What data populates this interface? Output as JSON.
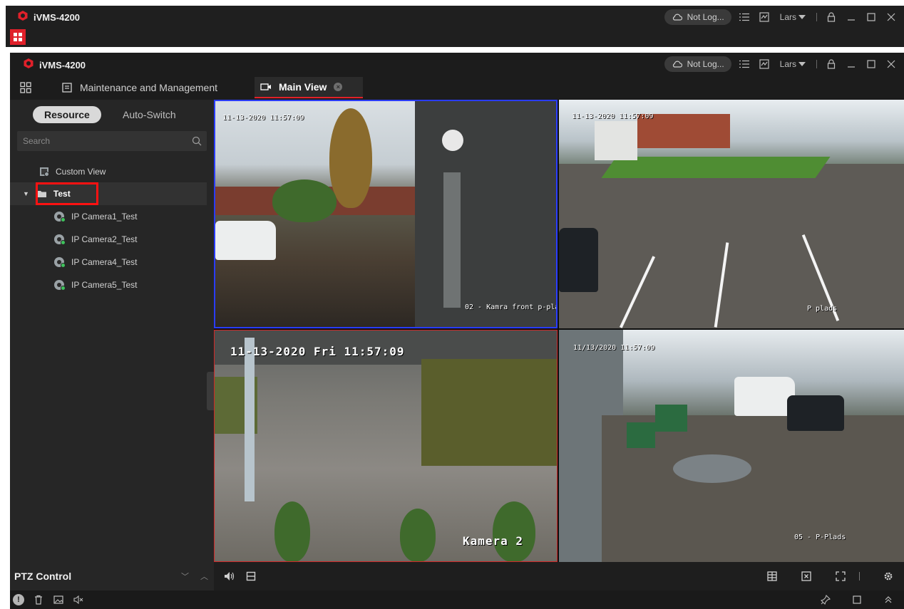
{
  "app": {
    "name": "iVMS-4200",
    "account_status": "Not Log...",
    "user": "Lars"
  },
  "tabs": {
    "maintenance": "Maintenance and Management",
    "main_view": "Main View"
  },
  "sidebar": {
    "resource_tab": "Resource",
    "autoswitch_tab": "Auto-Switch",
    "search_placeholder": "Search",
    "tree": {
      "custom_view": "Custom View",
      "group": "Test",
      "cameras": [
        "IP Camera1_Test",
        "IP Camera2_Test",
        "IP Camera4_Test",
        "IP Camera5_Test"
      ]
    },
    "ptz_title": "PTZ Control"
  },
  "videos": {
    "tile1": {
      "timestamp": "11-13-2020 11:57:09",
      "label": "02 - Kamra front p-pla"
    },
    "tile2": {
      "timestamp": "11-13-2020 11:57:09",
      "label": "P plads"
    },
    "tile3": {
      "timestamp": "11-13-2020 Fri 11:57:09",
      "label": "Kamera 2"
    },
    "tile4": {
      "timestamp": "11/13/2020 11:57:09",
      "label": "05 - P-Plads"
    }
  },
  "colors": {
    "accent": "#e0202a",
    "highlight_box": "#ff1212",
    "selected_tile_border": "#2a3cff",
    "online_dot": "#3ec25c"
  }
}
